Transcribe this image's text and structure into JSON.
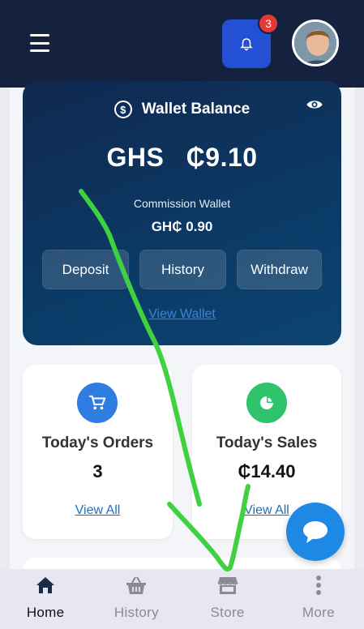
{
  "header": {
    "notification_count": "3"
  },
  "wallet": {
    "title": "Wallet Balance",
    "balance": "GHS ₵9.10",
    "commission_label": "Commission Wallet",
    "commission_value": "GH₵ 0.90",
    "buttons": {
      "deposit": "Deposit",
      "history": "History",
      "withdraw": "Withdraw"
    },
    "view_link": "View Wallet"
  },
  "cards": {
    "orders": {
      "title": "Today's Orders",
      "value": "3",
      "link": "View All",
      "icon": "cart-icon",
      "color": "#2f7de1"
    },
    "sales": {
      "title": "Today's Sales",
      "value": "₵14.40",
      "link": "View All",
      "icon": "pie-chart-icon",
      "color": "#2fc36b"
    }
  },
  "bottom_nav": {
    "items": [
      {
        "label": "Home",
        "icon": "home-icon",
        "active": true
      },
      {
        "label": "History",
        "icon": "basket-icon",
        "active": false
      },
      {
        "label": "Store",
        "icon": "store-icon",
        "active": false
      },
      {
        "label": "More",
        "icon": "more-vertical-icon",
        "active": false
      }
    ]
  },
  "colors": {
    "header_bg": "#14223f",
    "notification_button": "#2450d6",
    "badge": "#e53935",
    "wallet_bg": "#0b3a66",
    "link": "#1f6fb8",
    "chat_fab": "#1e88e5",
    "scribble": "#3fd13f"
  }
}
